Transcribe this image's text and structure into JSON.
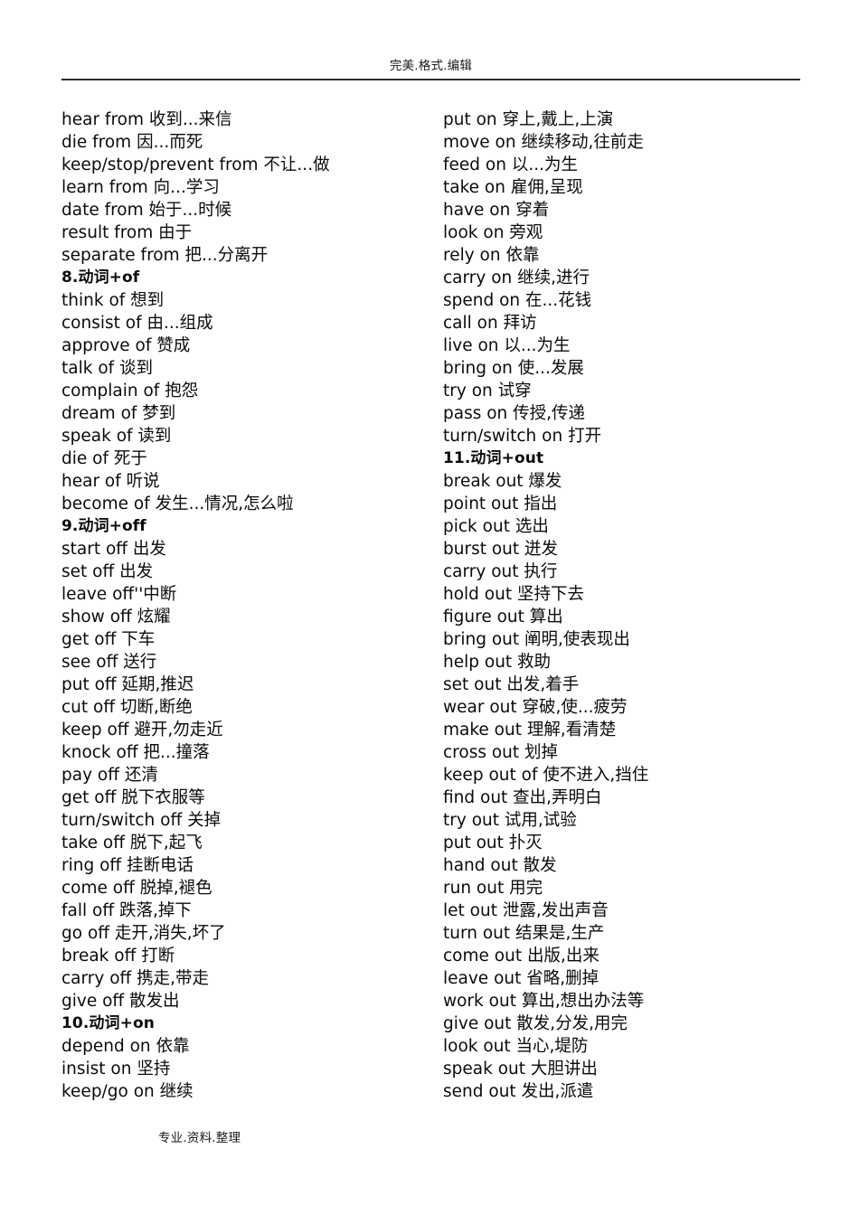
{
  "header": {
    "title": "完美.格式.编辑"
  },
  "footer": {
    "text": "专业.资料.整理"
  },
  "columns": {
    "left": [
      {
        "text": "hear from 收到...来信",
        "heading": false
      },
      {
        "text": "die from 因...而死",
        "heading": false
      },
      {
        "text": "keep/stop/prevent from 不让...做",
        "heading": false
      },
      {
        "text": "learn from 向...学习",
        "heading": false
      },
      {
        "text": "date from 始于...时候",
        "heading": false
      },
      {
        "text": "result from 由于",
        "heading": false
      },
      {
        "text": "separate from 把...分离开",
        "heading": false
      },
      {
        "text": "8.动词+of",
        "heading": true
      },
      {
        "text": "think of 想到",
        "heading": false
      },
      {
        "text": "consist of 由...组成",
        "heading": false
      },
      {
        "text": "approve of 赞成",
        "heading": false
      },
      {
        "text": "talk of 谈到",
        "heading": false
      },
      {
        "text": "complain of 抱怨",
        "heading": false
      },
      {
        "text": "dream of 梦到",
        "heading": false
      },
      {
        "text": "speak of 读到",
        "heading": false
      },
      {
        "text": "die of 死于",
        "heading": false
      },
      {
        "text": "hear of 听说",
        "heading": false
      },
      {
        "text": "become of 发生...情况,怎么啦",
        "heading": false
      },
      {
        "text": "9.动词+off",
        "heading": true
      },
      {
        "text": "start off 出发",
        "heading": false
      },
      {
        "text": "set off 出发",
        "heading": false
      },
      {
        "text": "leave off''中断",
        "heading": false
      },
      {
        "text": "show off 炫耀",
        "heading": false
      },
      {
        "text": "get off 下车",
        "heading": false
      },
      {
        "text": "see off 送行",
        "heading": false
      },
      {
        "text": "put off 延期,推迟",
        "heading": false
      },
      {
        "text": "cut off 切断,断绝",
        "heading": false
      },
      {
        "text": "keep off 避开,勿走近",
        "heading": false
      },
      {
        "text": "knock off 把...撞落",
        "heading": false
      },
      {
        "text": "pay off 还清",
        "heading": false
      },
      {
        "text": "get off 脱下衣服等",
        "heading": false
      },
      {
        "text": "turn/switch off 关掉",
        "heading": false
      },
      {
        "text": "take off 脱下,起飞",
        "heading": false
      },
      {
        "text": "ring off 挂断电话",
        "heading": false
      },
      {
        "text": "come off 脱掉,褪色",
        "heading": false
      },
      {
        "text": "fall off 跌落,掉下",
        "heading": false
      },
      {
        "text": "go off 走开,消失,坏了",
        "heading": false
      },
      {
        "text": "break off 打断",
        "heading": false
      },
      {
        "text": "carry off 携走,带走",
        "heading": false
      },
      {
        "text": "give off 散发出",
        "heading": false
      },
      {
        "text": "10.动词+on",
        "heading": true
      },
      {
        "text": "depend on 依靠",
        "heading": false
      },
      {
        "text": "insist on 坚持",
        "heading": false
      },
      {
        "text": "keep/go on 继续",
        "heading": false
      }
    ],
    "right": [
      {
        "text": "put on 穿上,戴上,上演",
        "heading": false
      },
      {
        "text": "move on 继续移动,往前走",
        "heading": false
      },
      {
        "text": "feed on 以...为生",
        "heading": false
      },
      {
        "text": "take on 雇佣,呈现",
        "heading": false
      },
      {
        "text": "have on 穿着",
        "heading": false
      },
      {
        "text": "look on 旁观",
        "heading": false
      },
      {
        "text": "rely on 依靠",
        "heading": false
      },
      {
        "text": "carry on 继续,进行",
        "heading": false
      },
      {
        "text": "spend on 在...花钱",
        "heading": false
      },
      {
        "text": "call on 拜访",
        "heading": false
      },
      {
        "text": "live on 以...为生",
        "heading": false
      },
      {
        "text": "bring on 使...发展",
        "heading": false
      },
      {
        "text": "try on 试穿",
        "heading": false
      },
      {
        "text": "pass on 传授,传递",
        "heading": false
      },
      {
        "text": "turn/switch on 打开",
        "heading": false
      },
      {
        "text": "11.动词+out",
        "heading": true
      },
      {
        "text": "break out 爆发",
        "heading": false
      },
      {
        "text": "point out 指出",
        "heading": false
      },
      {
        "text": "pick out 选出",
        "heading": false
      },
      {
        "text": "burst out 迸发",
        "heading": false
      },
      {
        "text": "carry out 执行",
        "heading": false
      },
      {
        "text": "hold out 坚持下去",
        "heading": false
      },
      {
        "text": "figure out 算出",
        "heading": false
      },
      {
        "text": "bring out 阐明,使表现出",
        "heading": false
      },
      {
        "text": "help out 救助",
        "heading": false
      },
      {
        "text": "set out 出发,着手",
        "heading": false
      },
      {
        "text": "wear out 穿破,使...疲劳",
        "heading": false
      },
      {
        "text": "make out 理解,看清楚",
        "heading": false
      },
      {
        "text": "cross out 划掉",
        "heading": false
      },
      {
        "text": "keep out of 使不进入,挡住",
        "heading": false
      },
      {
        "text": "find out 查出,弄明白",
        "heading": false
      },
      {
        "text": "try out 试用,试验",
        "heading": false
      },
      {
        "text": "put out 扑灭",
        "heading": false
      },
      {
        "text": "hand out 散发",
        "heading": false
      },
      {
        "text": "run out 用完",
        "heading": false
      },
      {
        "text": "let out 泄露,发出声音",
        "heading": false
      },
      {
        "text": "turn out 结果是,生产",
        "heading": false
      },
      {
        "text": "come out 出版,出来",
        "heading": false
      },
      {
        "text": "leave out 省略,删掉",
        "heading": false
      },
      {
        "text": "work out 算出,想出办法等",
        "heading": false
      },
      {
        "text": "give out 散发,分发,用完",
        "heading": false
      },
      {
        "text": "look out 当心,堤防",
        "heading": false
      },
      {
        "text": "speak out 大胆讲出",
        "heading": false
      },
      {
        "text": "send out 发出,派遣",
        "heading": false
      }
    ]
  }
}
